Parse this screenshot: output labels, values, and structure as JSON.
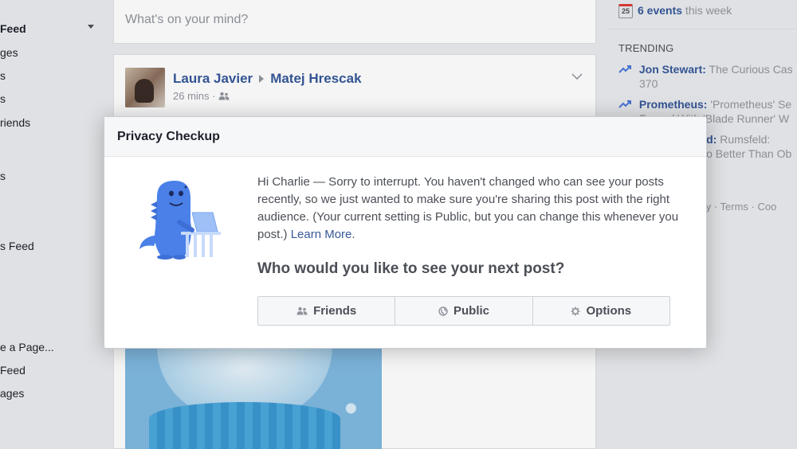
{
  "left_nav": {
    "items": [
      {
        "label": "Feed",
        "bold": true
      },
      {
        "label": "ges"
      },
      {
        "label": "s"
      },
      {
        "label": "s"
      },
      {
        "label": "riends"
      },
      {
        "label": "s"
      },
      {
        "label": "s Feed"
      },
      {
        "label": "e a Page..."
      },
      {
        "label": " Feed"
      },
      {
        "label": "ages"
      }
    ]
  },
  "composer": {
    "placeholder": "What's on your mind?"
  },
  "post": {
    "author": "Laura Javier",
    "recipient": "Matej Hrescak",
    "time": "26 mins · "
  },
  "right_col": {
    "events_count": "6 events",
    "events_suffix": " this week",
    "calendar_day": "25",
    "trending_title": "TRENDING",
    "trending": [
      {
        "name": "Jon Stewart:",
        "text": " The Curious Cas",
        "sub": "370"
      },
      {
        "name": "Prometheus:",
        "text": " 'Prometheus' Se",
        "sub": "Forged With 'Blade Runner' W"
      },
      {
        "name": "sfeld:",
        "text": " Rumsfeld:",
        "sub": "Do Better Than Ob"
      }
    ],
    "footer": "acy · Terms · Coo"
  },
  "modal": {
    "title": "Privacy Checkup",
    "message": "Hi Charlie — Sorry to interrupt. You haven't changed who can see your posts recently, so we just wanted to make sure you're sharing this post with the right audience. (Your current setting is Public, but you can change this whenever you post.) ",
    "learn_more": "Learn More",
    "message_end": ".",
    "question": "Who would you like to see your next post?",
    "buttons": [
      {
        "label": "Friends",
        "icon": "friends-icon"
      },
      {
        "label": "Public",
        "icon": "globe-icon"
      },
      {
        "label": "Options",
        "icon": "gear-icon"
      }
    ]
  },
  "colors": {
    "link": "#365899",
    "accent": "#4267b2",
    "dino": "#4a80e8",
    "text_muted": "#90949c",
    "bg": "#e9ebee"
  }
}
